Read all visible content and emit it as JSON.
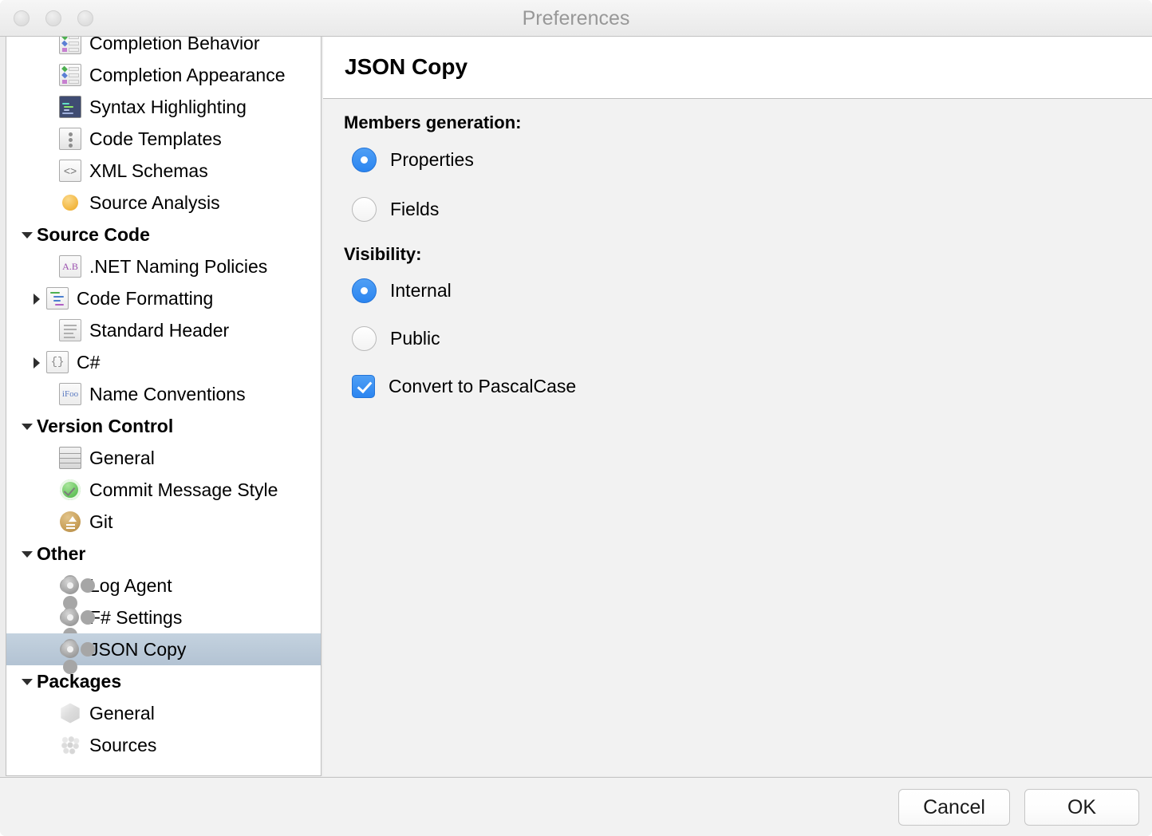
{
  "window": {
    "title": "Preferences",
    "traffic_lights": [
      "close",
      "minimize",
      "zoom"
    ]
  },
  "sidebar": {
    "items": [
      {
        "label": "Completion Behavior",
        "icon": "completion-list-icon",
        "level": 1,
        "twisty": "none",
        "group": false,
        "selected": false
      },
      {
        "label": "Completion Appearance",
        "icon": "completion-list-icon",
        "level": 1,
        "twisty": "none",
        "group": false,
        "selected": false
      },
      {
        "label": "Syntax Highlighting",
        "icon": "syntax-window-icon",
        "level": 1,
        "twisty": "none",
        "group": false,
        "selected": false
      },
      {
        "label": "Code Templates",
        "icon": "code-template-icon",
        "level": 1,
        "twisty": "none",
        "group": false,
        "selected": false
      },
      {
        "label": "XML Schemas",
        "icon": "xml-document-icon",
        "level": 1,
        "twisty": "none",
        "group": false,
        "selected": false
      },
      {
        "label": "Source Analysis",
        "icon": "orange-dot-icon",
        "level": 1,
        "twisty": "none",
        "group": false,
        "selected": false
      },
      {
        "label": "Source Code",
        "icon": "",
        "level": 0,
        "twisty": "down",
        "group": true,
        "selected": false
      },
      {
        "label": ".NET Naming Policies",
        "icon": "ab-tag-icon",
        "level": 1,
        "twisty": "none",
        "group": false,
        "selected": false
      },
      {
        "label": "Code Formatting",
        "icon": "code-formatting-icon",
        "level": 1,
        "twisty": "right",
        "group": false,
        "selected": false
      },
      {
        "label": "Standard Header",
        "icon": "page-lines-icon",
        "level": 1,
        "twisty": "none",
        "group": false,
        "selected": false
      },
      {
        "label": "C#",
        "icon": "braces-document-icon",
        "level": 1,
        "twisty": "right",
        "group": false,
        "selected": false
      },
      {
        "label": "Name Conventions",
        "icon": "ifoo-tag-icon",
        "level": 1,
        "twisty": "none",
        "group": false,
        "selected": false
      },
      {
        "label": "Version Control",
        "icon": "",
        "level": 0,
        "twisty": "down",
        "group": true,
        "selected": false
      },
      {
        "label": "General",
        "icon": "server-stack-icon",
        "level": 1,
        "twisty": "none",
        "group": false,
        "selected": false
      },
      {
        "label": "Commit Message Style",
        "icon": "green-check-icon",
        "level": 1,
        "twisty": "none",
        "group": false,
        "selected": false
      },
      {
        "label": "Git",
        "icon": "git-upload-icon",
        "level": 1,
        "twisty": "none",
        "group": false,
        "selected": false
      },
      {
        "label": "Other",
        "icon": "",
        "level": 0,
        "twisty": "down",
        "group": true,
        "selected": false
      },
      {
        "label": "Log Agent",
        "icon": "gear-icon",
        "level": 1,
        "twisty": "none",
        "group": false,
        "selected": false
      },
      {
        "label": "F# Settings",
        "icon": "gear-icon",
        "level": 1,
        "twisty": "none",
        "group": false,
        "selected": false
      },
      {
        "label": "JSON Copy",
        "icon": "gear-icon",
        "level": 1,
        "twisty": "none",
        "group": false,
        "selected": true
      },
      {
        "label": "Packages",
        "icon": "",
        "level": 0,
        "twisty": "down",
        "group": true,
        "selected": false
      },
      {
        "label": "General",
        "icon": "cube-icon",
        "level": 1,
        "twisty": "none",
        "group": false,
        "selected": false
      },
      {
        "label": "Sources",
        "icon": "spheres-icon",
        "level": 1,
        "twisty": "none",
        "group": false,
        "selected": false
      }
    ]
  },
  "panel": {
    "title": "JSON Copy",
    "members_label": "Members generation:",
    "visibility_label": "Visibility:",
    "members_options": [
      {
        "label": "Properties",
        "checked": true
      },
      {
        "label": "Fields",
        "checked": false
      }
    ],
    "visibility_options": [
      {
        "label": "Internal",
        "checked": true
      },
      {
        "label": "Public",
        "checked": false
      }
    ],
    "pascal_case": {
      "label": "Convert to PascalCase",
      "checked": true
    }
  },
  "footer": {
    "cancel_label": "Cancel",
    "ok_label": "OK"
  },
  "colors": {
    "accent": "#2b85f0",
    "selection": "#b3c3d3",
    "title_text": "#989898"
  }
}
